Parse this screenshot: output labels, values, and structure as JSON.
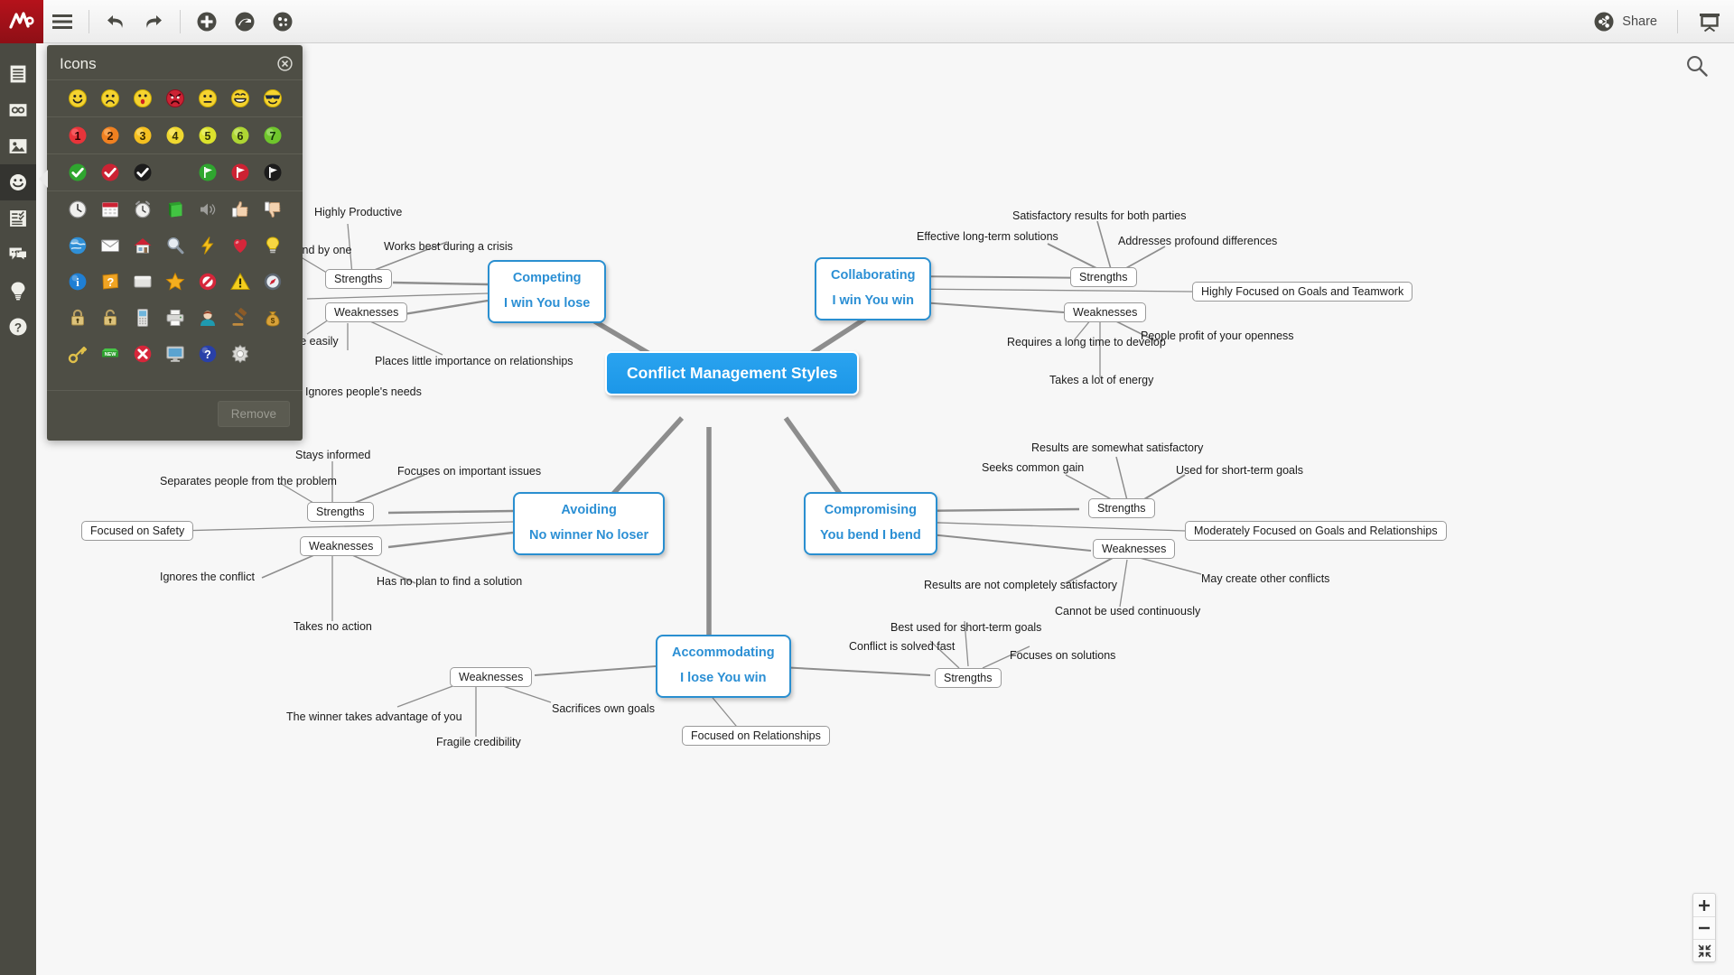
{
  "app": {
    "brand_color": "#b5121b",
    "accent_color": "#2a8fd0",
    "central_color": "#1c97e8"
  },
  "toolbar": {
    "menu_label": "",
    "undo_label": "",
    "redo_label": "",
    "add_label": "",
    "share_label": "Share"
  },
  "sidebar": {
    "items": [
      {
        "icon": "notes-icon",
        "name": "sidebar-item-notes"
      },
      {
        "icon": "link-icon",
        "name": "sidebar-item-link"
      },
      {
        "icon": "image-icon",
        "name": "sidebar-item-image"
      },
      {
        "icon": "smiley-icon",
        "name": "sidebar-item-icons"
      },
      {
        "icon": "task-icon",
        "name": "sidebar-item-task"
      },
      {
        "icon": "comment-icon",
        "name": "sidebar-item-comment"
      },
      {
        "icon": "lightbulb-icon",
        "name": "sidebar-item-ideas"
      },
      {
        "icon": "help-icon",
        "name": "sidebar-item-help"
      }
    ]
  },
  "icons_panel": {
    "title": "Icons",
    "remove_label": "Remove",
    "sections": [
      {
        "name": "smileys",
        "rows": [
          [
            "smiley-happy-icon",
            "smiley-sad-icon",
            "smiley-surprised-icon",
            "smiley-angry-icon",
            "smiley-neutral-icon",
            "smiley-laugh-icon",
            "smiley-cool-icon"
          ]
        ]
      },
      {
        "name": "numbers",
        "rows": [
          [
            "number-1-icon",
            "number-2-icon",
            "number-3-icon",
            "number-4-icon",
            "number-5-icon",
            "number-6-icon",
            "number-7-icon"
          ]
        ]
      },
      {
        "name": "marks",
        "rows": [
          [
            "check-green-icon",
            "check-red-icon",
            "check-black-icon",
            "blank-icon",
            "flag-green-icon",
            "flag-red-icon",
            "flag-black-icon"
          ]
        ]
      },
      {
        "name": "objects",
        "rows": [
          [
            "clock-icon",
            "calendar-icon",
            "alarm-clock-icon",
            "book-icon",
            "speaker-icon",
            "thumbs-up-icon",
            "thumbs-down-icon"
          ],
          [
            "globe-icon",
            "mail-icon",
            "home-icon",
            "magnifier-icon",
            "lightning-icon",
            "heart-icon",
            "bulb-icon"
          ],
          [
            "info-icon",
            "question-icon",
            "folder-icon",
            "star-icon",
            "forbidden-icon",
            "warning-icon",
            "compass-icon"
          ],
          [
            "lock-closed-icon",
            "lock-open-icon",
            "mobile-icon",
            "printer-icon",
            "person-icon",
            "gavel-icon",
            "money-bag-icon"
          ],
          [
            "key-icon",
            "new-icon",
            "delete-icon",
            "monitor-icon",
            "help-circle-icon",
            "gear-icon",
            "blank-icon"
          ]
        ]
      }
    ]
  },
  "canvas": {
    "search_icon": "search-icon",
    "zoom_in": "plus-icon",
    "zoom_out": "minus-icon",
    "fit": "fit-screen-icon"
  },
  "mindmap": {
    "central": "Conflict Management Styles",
    "strengths_label": "Strengths",
    "weaknesses_label": "Weaknesses",
    "branches": [
      {
        "title": "Competing",
        "subtitle": "I win You lose",
        "focus": "",
        "strengths": [
          "Highly Productive",
          "Works best during a crisis",
          "Decisions are made fast and by one"
        ],
        "weaknesses": [
          "Places little importance on relationships",
          "Ignores people's needs",
          "Creates resistance easily"
        ]
      },
      {
        "title": "Collaborating",
        "subtitle": "I win You win",
        "focus": "Highly Focused on Goals and Teamwork",
        "strengths": [
          "Effective long-term solutions",
          "Satisfactory results for both parties",
          "Addresses profound differences"
        ],
        "weaknesses": [
          "Requires a long time to develop",
          "People profit of your openness",
          "Takes a lot of energy"
        ]
      },
      {
        "title": "Avoiding",
        "subtitle": "No winner No loser",
        "focus": "Focused on Safety",
        "strengths": [
          "Separates people from the problem",
          "Stays informed",
          "Focuses on important issues"
        ],
        "weaknesses": [
          "Ignores the conflict",
          "Takes no action",
          "Has no plan to find a solution"
        ]
      },
      {
        "title": "Compromising",
        "subtitle": "You bend I bend",
        "focus": "Moderately Focused on Goals and Relationships",
        "strengths": [
          "Seeks common gain",
          "Results are somewhat satisfactory",
          "Used for short-term goals"
        ],
        "weaknesses": [
          "Results are not completely satisfactory",
          "Cannot be used continuously",
          "May create other conflicts"
        ]
      },
      {
        "title": "Accommodating",
        "subtitle": "I lose You win",
        "focus": "Focused on Relationships",
        "strengths": [
          "Conflict is solved fast",
          "Best used for short-term goals",
          "Focuses on solutions"
        ],
        "weaknesses": [
          "The winner takes advantage of you",
          "Fragile credibility",
          "Sacrifices own goals"
        ]
      }
    ]
  }
}
